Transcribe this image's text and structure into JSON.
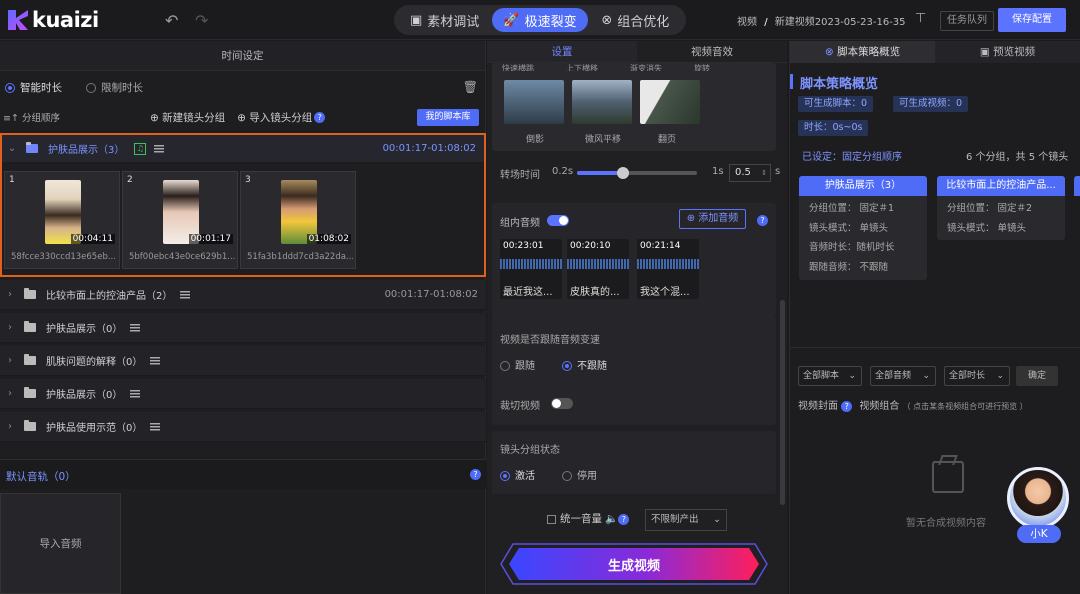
{
  "topbar": {
    "logo_text": "kuaizi",
    "modes": [
      "素材调试",
      "极速裂变",
      "组合优化"
    ],
    "breadcrumb_1": "视频",
    "breadcrumb_sep": "/",
    "breadcrumb_2": "新建视频2023-05-23-16-35",
    "task_queue": "任务队列",
    "save_config": "保存配置"
  },
  "left": {
    "header": "时间设定",
    "smart_duration": "智能时长",
    "limit_duration": "限制时长",
    "group_order": "分组顺序",
    "new_group": "新建镜头分组",
    "import_group": "导入镜头分组",
    "my_script_lib": "我的脚本库",
    "expanded_group": {
      "label": "护肤品展示（3）",
      "time": "00:01:17-01:08:02",
      "clips": [
        {
          "num": "1",
          "dur": "00:04:11",
          "name": "58fcce330ccd13e65eb..."
        },
        {
          "num": "2",
          "dur": "00:01:17",
          "name": "5bf00ebc43e0ce629b1..."
        },
        {
          "num": "3",
          "dur": "01:08:02",
          "name": "51fa3b1ddd7cd3a22da..."
        }
      ]
    },
    "groups": [
      {
        "label": "比较市面上的控油产品（2）",
        "time": "00:01:17-01:08:02"
      },
      {
        "label": "护肤品展示（0）",
        "time": ""
      },
      {
        "label": "肌肤问题的解释（0）",
        "time": ""
      },
      {
        "label": "护肤品展示（0）",
        "time": ""
      },
      {
        "label": "护肤品使用示范（0）",
        "time": ""
      }
    ],
    "default_track": "默认音轨（0）",
    "import_audio": "导入音频"
  },
  "mid": {
    "tabs": [
      "设置",
      "视频音效"
    ],
    "transitions_top": [
      "快速横跳",
      "上下横移",
      "渐变消失",
      "旋转"
    ],
    "transitions": [
      "倒影",
      "微风平移",
      "翻页"
    ],
    "transition_time": "转场时间",
    "t_min": "0.2s",
    "t_max": "1s",
    "t_value": "0.5",
    "t_unit": "s",
    "group_audio": "组内音频",
    "add_audio": "添加音频",
    "waves": [
      {
        "time": "00:23:01",
        "text": "最近我这..."
      },
      {
        "time": "00:20:10",
        "text": "皮肤真的..."
      },
      {
        "time": "00:21:14",
        "text": "我这个混..."
      }
    ],
    "follow_q": "视频是否跟随音频变速",
    "follow": "跟随",
    "no_follow": "不跟随",
    "crop_video": "裁切视频",
    "group_status": "镜头分组状态",
    "activate": "激活",
    "disable": "停用",
    "unify_volume": "统一音量",
    "output_limit": "不限制产出",
    "generate": "生成视频"
  },
  "right": {
    "tabs": [
      "脚本策略概览",
      "预览视频"
    ],
    "title": "脚本策略概览",
    "gen_scripts": "可生成脚本：0",
    "gen_videos": "可生成视频：0",
    "duration": "时长：0s~0s",
    "preset": "已设定：固定分组顺序",
    "summary": "6 个分组，共 5 个镜头",
    "cards": [
      {
        "head": "护肤品展示（3）",
        "lines": [
          "分组位置：  固定＃1",
          "镜头模式：  单镜头",
          "音频时长：随机时长",
          "跟随音频：  不跟随"
        ]
      },
      {
        "head": "比较市面上的控油产品...",
        "lines": [
          "分组位置：  固定＃2",
          "镜头模式：  单镜头"
        ]
      }
    ],
    "filters": [
      "全部脚本",
      "全部音频",
      "全部时长"
    ],
    "confirm": "确定",
    "cover": "视频封面",
    "combo": "视频组合",
    "combo_hint": "（ 点击某条视频组合可进行预览 ）",
    "empty": "暂无合成视频内容",
    "assistant": "小K"
  }
}
